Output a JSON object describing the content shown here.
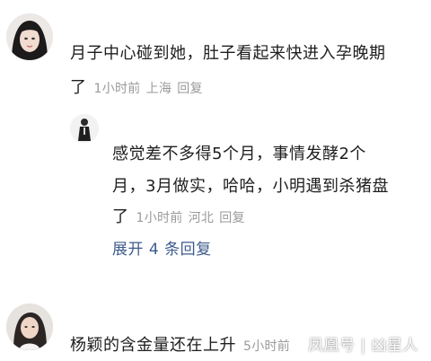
{
  "comment1": {
    "text_line1": "月子中心碰到她，肚子看起来快进入孕晚期",
    "text_line2": "了",
    "time": "1小时前",
    "location": "上海",
    "reply_label": "回复"
  },
  "reply1": {
    "text_line1": "感觉差不多得5个月，事情发酵2个",
    "text_line2": "月，3月做实，哈哈，小明遇到杀猪盘",
    "text_line3": "了",
    "time": "1小时前",
    "location": "河北",
    "reply_label": "回复"
  },
  "expand_replies": "展开 4 条回复",
  "comment2": {
    "text": "杨颖的含金量还在上升",
    "time": "5小时前"
  },
  "watermark": "凤凰号 | 凶星人"
}
